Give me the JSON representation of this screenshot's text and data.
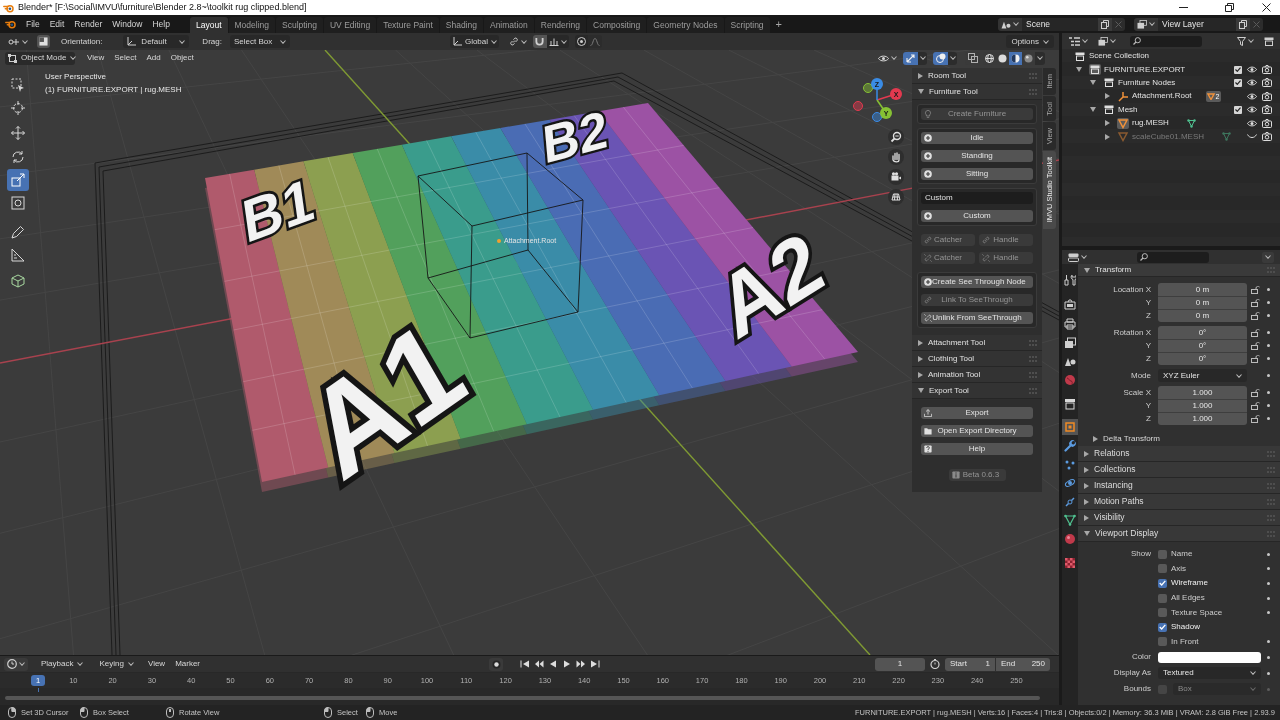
{
  "title_bar": {
    "title": "Blender* [F:\\Social\\IMVU\\furniture\\Blender 2.8~\\toolkit rug clipped.blend]"
  },
  "menu_bar": {
    "menus": [
      "File",
      "Edit",
      "Render",
      "Window",
      "Help"
    ],
    "workspaces": [
      {
        "label": "Layout",
        "selected": true
      },
      {
        "label": "Modeling",
        "selected": false
      },
      {
        "label": "Sculpting",
        "selected": false
      },
      {
        "label": "UV Editing",
        "selected": false
      },
      {
        "label": "Texture Paint",
        "selected": false
      },
      {
        "label": "Shading",
        "selected": false
      },
      {
        "label": "Animation",
        "selected": false
      },
      {
        "label": "Rendering",
        "selected": false
      },
      {
        "label": "Compositing",
        "selected": false
      },
      {
        "label": "Geometry Nodes",
        "selected": false
      },
      {
        "label": "Scripting",
        "selected": false
      }
    ],
    "add_tab": "+",
    "scene": "Scene",
    "view_layer": "View Layer"
  },
  "tool_header": {
    "orientation_label": "Orientation:",
    "orientation": "Default",
    "drag_label": "Drag:",
    "drag": "Select Box",
    "transform_orientation": "Global",
    "options": "Options"
  },
  "viewport": {
    "header": {
      "mode": "Object Mode",
      "menus": [
        "View",
        "Select",
        "Add",
        "Object"
      ],
      "toggles": [
        {
          "on": true
        },
        {
          "on": true
        },
        {
          "on": false
        }
      ],
      "shading_modes": [
        {
          "selected": false
        },
        {
          "selected": false
        },
        {
          "selected": true
        },
        {
          "selected": false
        }
      ]
    },
    "tools": [
      {
        "selected": false
      },
      {
        "selected": false
      },
      {
        "selected": false
      },
      {
        "selected": false
      },
      {
        "selected": true
      },
      {
        "selected": false
      },
      {
        "selected": false
      },
      {
        "selected": false
      },
      {
        "selected": false
      }
    ],
    "view_name": "User Perspective",
    "object_info": "(1) FURNITURE.EXPORT | rug.MESH",
    "rug_labels": [
      "B1",
      "B2",
      "A2",
      "A1"
    ],
    "object_label": "Attachment.Root",
    "gizmo": {
      "axes": [
        {
          "label": "X",
          "color": "#e3394f"
        },
        {
          "label": "Y",
          "color": "#86c134"
        },
        {
          "label": "Z",
          "color": "#3a8ce6"
        }
      ]
    }
  },
  "sidebar": {
    "tabs": [
      {
        "label": "Item",
        "selected": false
      },
      {
        "label": "Tool",
        "selected": false
      },
      {
        "label": "View",
        "selected": false
      },
      {
        "label": "IMVU Studio Toolkit",
        "selected": true
      }
    ],
    "panels": [
      {
        "title": "Room Tool",
        "expanded": false
      },
      {
        "title": "Furniture Tool",
        "expanded": true,
        "groups": [
          {
            "kind": "box",
            "rows": [
              [
                {
                  "kind": "button",
                  "label": "Create Furniture",
                  "disabled": true
                }
              ]
            ]
          },
          {
            "kind": "box",
            "rows": [
              [
                {
                  "kind": "button",
                  "label": "Idle",
                  "disabled": false
                }
              ],
              [
                {
                  "kind": "button",
                  "label": "Standing",
                  "disabled": false
                }
              ],
              [
                {
                  "kind": "button",
                  "label": "Sitting",
                  "disabled": false
                }
              ]
            ]
          },
          {
            "kind": "box",
            "rows": [
              [
                {
                  "kind": "field",
                  "value": "Custom"
                }
              ],
              [
                {
                  "kind": "button",
                  "label": "Custom",
                  "disabled": false
                }
              ]
            ]
          },
          {
            "kind": "plain",
            "rows": [
              [
                {
                  "kind": "button",
                  "label": "Catcher",
                  "disabled": true
                },
                {
                  "kind": "button",
                  "label": "Handle",
                  "disabled": true
                }
              ],
              [
                {
                  "kind": "button",
                  "label": "Catcher",
                  "disabled": true
                },
                {
                  "kind": "button",
                  "label": "Handle",
                  "disabled": true
                }
              ]
            ]
          },
          {
            "kind": "box",
            "rows": [
              [
                {
                  "kind": "button",
                  "label": "Create See Through Node",
                  "disabled": false
                }
              ],
              [
                {
                  "kind": "button",
                  "label": "Link To SeeThrough",
                  "disabled": true
                }
              ],
              [
                {
                  "kind": "button",
                  "label": "Unlink From SeeThrough",
                  "disabled": false
                }
              ]
            ]
          }
        ]
      },
      {
        "title": "Attachment Tool",
        "expanded": false
      },
      {
        "title": "Clothing Tool",
        "expanded": false
      },
      {
        "title": "Animation Tool",
        "expanded": false
      },
      {
        "title": "Export Tool",
        "expanded": true,
        "groups": [
          {
            "kind": "plain",
            "rows": [
              [
                {
                  "kind": "button",
                  "label": "Export",
                  "disabled": false
                }
              ],
              [
                {
                  "kind": "button",
                  "label": "Open Export Directory",
                  "disabled": false
                }
              ],
              [
                {
                  "kind": "button",
                  "label": "Help",
                  "disabled": false
                }
              ]
            ]
          },
          {
            "kind": "plain",
            "rows": [
              [
                {
                  "kind": "label",
                  "label": "Beta 0.6.3",
                  "disabled": true
                }
              ]
            ]
          }
        ]
      }
    ]
  },
  "outliner": {
    "tree": [
      {
        "label": "Scene Collection",
        "kind": "scene_collection",
        "children": [
          {
            "label": "FURNITURE.EXPORT",
            "kind": "collection",
            "expanded": true,
            "selected": true,
            "checked": true,
            "visible": true,
            "children": [
              {
                "label": "Furniture Nodes",
                "kind": "collection",
                "expanded": true,
                "selected": false,
                "checked": true,
                "visible": true,
                "children": [
                  {
                    "label": "Attachment.Root",
                    "kind": "empty",
                    "expanded": false,
                    "selected": false,
                    "visible": true,
                    "badge": "2"
                  }
                ]
              },
              {
                "label": "Mesh",
                "kind": "collection",
                "expanded": true,
                "selected": false,
                "checked": true,
                "visible": true,
                "children": [
                  {
                    "label": "rug.MESH",
                    "kind": "mesh",
                    "expanded": false,
                    "selected": true,
                    "visible": true
                  },
                  {
                    "label": "scaleCube01.MESH",
                    "kind": "mesh",
                    "expanded": false,
                    "selected": false,
                    "visible": false
                  }
                ]
              }
            ]
          }
        ]
      }
    ]
  },
  "properties": {
    "tabs": [
      {
        "selected": false
      },
      {
        "selected": false
      },
      {
        "selected": false
      },
      {
        "selected": false
      },
      {
        "selected": false
      },
      {
        "selected": false
      },
      {
        "selected": false
      },
      {
        "selected": true
      },
      {
        "selected": false
      },
      {
        "selected": false
      },
      {
        "selected": false
      },
      {
        "selected": false
      },
      {
        "selected": false
      },
      {
        "selected": false
      },
      {
        "selected": false
      }
    ],
    "transform": {
      "title": "Transform",
      "expanded": true,
      "groups": [
        [
          {
            "kind": "number",
            "label": "Location X",
            "value": "0 m",
            "locked": false
          },
          {
            "kind": "number",
            "label": "Y",
            "value": "0 m",
            "locked": false
          },
          {
            "kind": "number",
            "label": "Z",
            "value": "0 m",
            "locked": false
          }
        ],
        [
          {
            "kind": "number",
            "label": "Rotation X",
            "value": "0°",
            "locked": false
          },
          {
            "kind": "number",
            "label": "Y",
            "value": "0°",
            "locked": false
          },
          {
            "kind": "number",
            "label": "Z",
            "value": "0°",
            "locked": false
          }
        ],
        [
          {
            "kind": "dropdown",
            "label": "Mode",
            "value": "XYZ Euler"
          }
        ],
        [
          {
            "kind": "number",
            "label": "Scale X",
            "value": "1.000",
            "locked": false
          },
          {
            "kind": "number",
            "label": "Y",
            "value": "1.000",
            "locked": false
          },
          {
            "kind": "number",
            "label": "Z",
            "value": "1.000",
            "locked": false
          }
        ]
      ],
      "subpanels": [
        {
          "title": "Delta Transform",
          "expanded": false
        }
      ]
    },
    "panels": [
      {
        "title": "Relations",
        "expanded": false
      },
      {
        "title": "Collections",
        "expanded": false
      },
      {
        "title": "Instancing",
        "expanded": false
      },
      {
        "title": "Motion Paths",
        "expanded": false
      },
      {
        "title": "Visibility",
        "expanded": false
      },
      {
        "title": "Viewport Display",
        "expanded": true,
        "rows": [
          {
            "kind": "checkbox",
            "label": "Show",
            "text": "Name",
            "checked": false,
            "decorator": true
          },
          {
            "kind": "checkbox",
            "text": "Axis",
            "checked": false,
            "decorator": true
          },
          {
            "kind": "checkbox",
            "text": "Wireframe",
            "checked": true,
            "decorator": true
          },
          {
            "kind": "checkbox",
            "text": "All Edges",
            "checked": false,
            "decorator": true
          },
          {
            "kind": "checkbox",
            "text": "Texture Space",
            "checked": false,
            "decorator": true
          },
          {
            "kind": "checkbox",
            "text": "Shadow",
            "checked": true,
            "decorator": false
          },
          {
            "kind": "checkbox",
            "text": "In Front",
            "checked": false,
            "decorator": true
          },
          {
            "kind": "color",
            "label": "Color",
            "color": "#ffffff",
            "decorator": true
          },
          {
            "kind": "dropdown",
            "label": "Display As",
            "value": "Textured",
            "decorator": true
          },
          {
            "kind": "checkbox_dropdown",
            "label": "Bounds",
            "checked": false,
            "value": "Box",
            "disabled": true,
            "decorator": true
          }
        ]
      }
    ]
  },
  "timeline": {
    "menus": [
      "Playback",
      "Keying",
      "View",
      "Marker"
    ],
    "current_frame": "1",
    "start_label": "Start",
    "start": "1",
    "end_label": "End",
    "end": "250",
    "ruler": {
      "current": "1",
      "ticks": [
        "10",
        "20",
        "30",
        "40",
        "50",
        "60",
        "70",
        "80",
        "90",
        "100",
        "110",
        "120",
        "130",
        "140",
        "150",
        "160",
        "170",
        "180",
        "190",
        "200",
        "210",
        "220",
        "230",
        "240",
        "250"
      ]
    }
  },
  "status_bar": {
    "hints": [
      "Set 3D Cursor",
      "Box Select",
      "Rotate View",
      "Select",
      "Move"
    ],
    "stats": "FURNITURE.EXPORT | rug.MESH | Verts:16 | Faces:4 | Tris:8 | Objects:0/2 | Memory: 36.3 MiB | VRAM: 2.8 GiB Free | 2.93.9"
  }
}
